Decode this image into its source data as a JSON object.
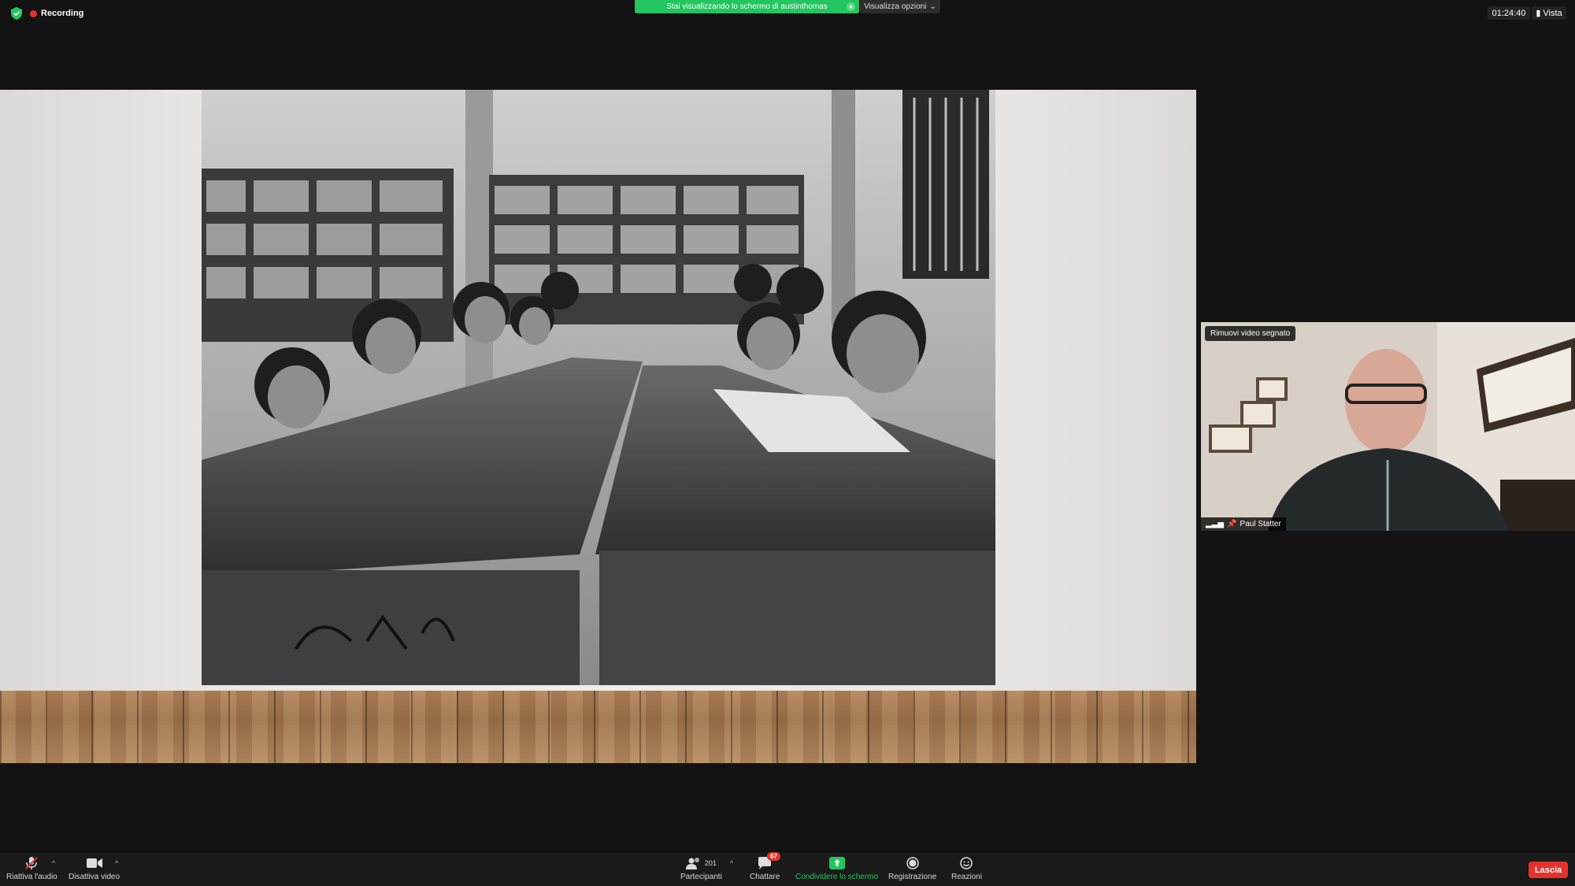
{
  "top_bar": {
    "recording_label": "Recording",
    "share_banner_text": "Stai visualizzando lo schermo di austinthomas",
    "view_options_label": "Visualizza opzioni",
    "meeting_time": "01:24:40",
    "view_label": "Vista"
  },
  "participant_video": {
    "pin_label": "Rimuovi video segnato",
    "name": "Paul Statter"
  },
  "toolbar": {
    "audio_label": "Riattiva l'audio",
    "video_label": "Disattiva video",
    "participants_label": "Partecipanti",
    "participants_count": "201",
    "chat_label": "Chattare",
    "chat_badge": "67",
    "share_label": "Condividere lo schermo",
    "record_label": "Registrazione",
    "reactions_label": "Reazioni",
    "leave_label": "Lascia"
  },
  "colors": {
    "accent_green": "#22c55e",
    "leave_red": "#e5322d",
    "background": "#131313"
  },
  "icons": [
    "shield-icon",
    "recording-dot-icon",
    "chevron-down-icon",
    "microphone-muted-icon",
    "camera-icon",
    "participants-icon",
    "chat-icon",
    "share-screen-icon",
    "record-icon",
    "reactions-icon",
    "signal-icon",
    "pin-icon"
  ]
}
